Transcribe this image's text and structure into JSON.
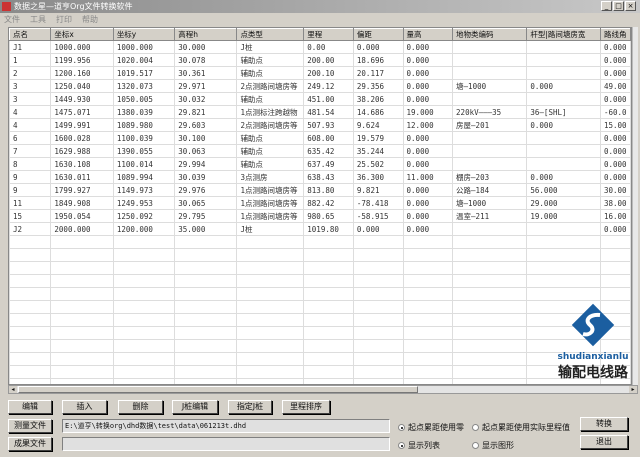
{
  "window": {
    "title": "数据之星—道亨Org文件转换软件",
    "minimize": "_",
    "maximize": "□",
    "close": "×"
  },
  "menu": [
    "文件",
    "工具",
    "打印",
    "帮助"
  ],
  "table": {
    "columns": [
      "点名",
      "坐标x",
      "坐标y",
      "高程h",
      "点类型",
      "里程",
      "偏距",
      "量高",
      "地物类编码",
      "杆型|路间塘房宽",
      "路线角"
    ],
    "rows": [
      [
        "J1",
        "1000.000",
        "1000.000",
        "30.000",
        "J桩",
        "0.00",
        "0.000",
        "0.000",
        "",
        "",
        "0.000"
      ],
      [
        "1",
        "1199.956",
        "1020.004",
        "30.078",
        "辅助点",
        "200.00",
        "18.696",
        "0.000",
        "",
        "",
        "0.000"
      ],
      [
        "2",
        "1200.160",
        "1019.517",
        "30.361",
        "辅助点",
        "200.10",
        "20.117",
        "0.000",
        "",
        "",
        "0.000"
      ],
      [
        "3",
        "1250.040",
        "1320.073",
        "29.971",
        "2点测路间塘房等",
        "249.12",
        "29.356",
        "0.000",
        "塘—1000",
        "0.000",
        "49.00"
      ],
      [
        "3",
        "1449.930",
        "1050.005",
        "30.032",
        "辅助点",
        "451.00",
        "38.206",
        "0.000",
        "",
        "",
        "0.000"
      ],
      [
        "4",
        "1475.071",
        "1380.039",
        "29.821",
        "1点测标注跨越物",
        "481.54",
        "14.686",
        "19.000",
        "220kV———35",
        "36—[SHL]",
        "-60.0"
      ],
      [
        "4",
        "1499.991",
        "1089.980",
        "29.603",
        "2点测路间塘房等",
        "507.93",
        "9.624",
        "12.000",
        "房屋—201",
        "0.000",
        "15.00"
      ],
      [
        "6",
        "1600.028",
        "1100.039",
        "30.100",
        "辅助点",
        "608.00",
        "19.579",
        "0.000",
        "",
        "",
        "0.000"
      ],
      [
        "7",
        "1629.988",
        "1390.055",
        "30.063",
        "辅助点",
        "635.42",
        "35.244",
        "0.000",
        "",
        "",
        "0.000"
      ],
      [
        "8",
        "1630.108",
        "1100.014",
        "29.994",
        "辅助点",
        "637.49",
        "25.502",
        "0.000",
        "",
        "",
        "0.000"
      ],
      [
        "9",
        "1630.011",
        "1089.994",
        "30.039",
        "3点测房",
        "638.43",
        "36.300",
        "11.000",
        "棚房—203",
        "0.000",
        "0.000"
      ],
      [
        "9",
        "1799.927",
        "1149.973",
        "29.976",
        "1点测路间塘房等",
        "813.80",
        "9.821",
        "0.000",
        "公路—184",
        "56.000",
        "30.00"
      ],
      [
        "11",
        "1849.908",
        "1249.953",
        "30.065",
        "1点测路间塘房等",
        "882.42",
        "-78.418",
        "0.000",
        "塘—1000",
        "29.000",
        "38.00"
      ],
      [
        "15",
        "1950.054",
        "1250.092",
        "29.795",
        "1点测路间塘房等",
        "980.65",
        "-58.915",
        "0.000",
        "温室—211",
        "19.000",
        "16.00"
      ],
      [
        "J2",
        "2000.000",
        "1200.000",
        "35.000",
        "J桩",
        "1019.80",
        "0.000",
        "0.000",
        "",
        "",
        "0.000"
      ]
    ]
  },
  "buttons": {
    "edit": "编辑",
    "insert": "插入",
    "delete": "删除",
    "jedit": "J桩编辑",
    "setj": "指定J桩",
    "sort": "里程排序",
    "survey_file": "测量文件",
    "result_file": "成果文件",
    "convert": "转换",
    "exit": "退出"
  },
  "fields": {
    "survey_path": "E:\\道亨\\转换org\\dhd数据\\test\\data\\061213t.dhd",
    "result_path": ""
  },
  "options": {
    "start_zero": "起点累距使用零",
    "start_actual": "起点累距使用实际里程值",
    "show_list": "显示列表",
    "show_graph": "显示图形"
  },
  "logo": {
    "latin": "shudianxianlu",
    "cn": "输配电线路"
  },
  "colors": {
    "logo": "#1b5ea0"
  }
}
